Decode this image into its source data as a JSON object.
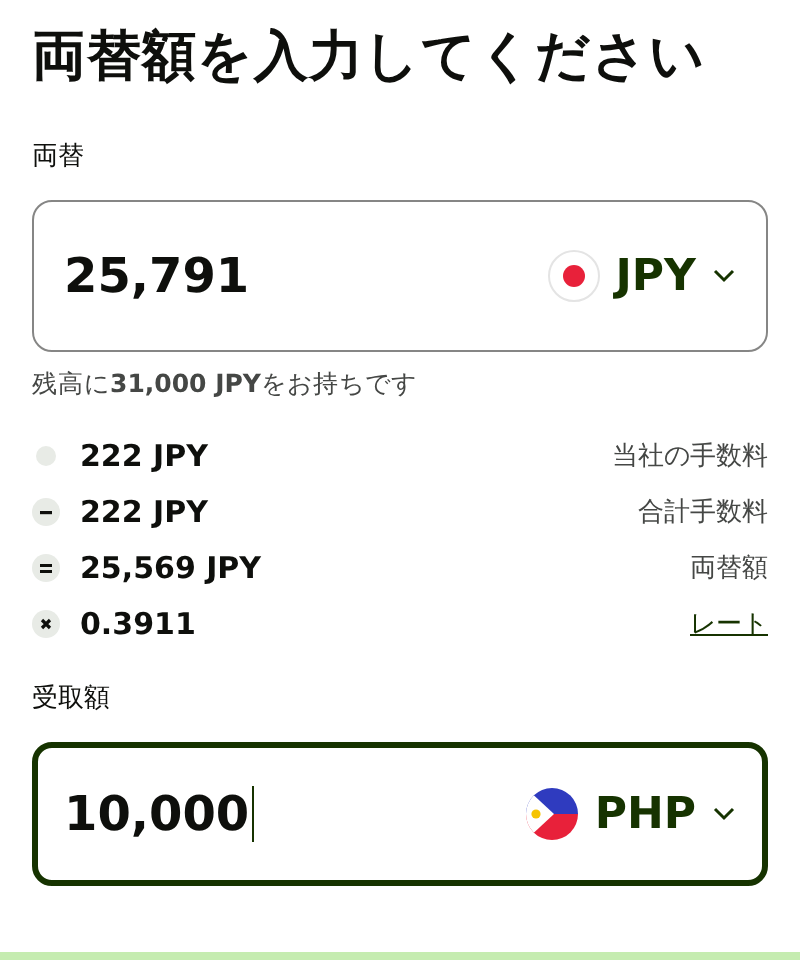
{
  "title": "両替額を入力してください",
  "send": {
    "label": "両替",
    "value": "25,791",
    "focused": false,
    "currency": {
      "code": "JPY",
      "kind": "jp"
    }
  },
  "balance_note": "残高に**31,000 JPY**をお持ちです",
  "breakdown": [
    {
      "kind": "dot",
      "amount": "222 JPY",
      "label": "当社の手数料",
      "link": false
    },
    {
      "kind": "minus",
      "amount": "222 JPY",
      "label": "合計手数料",
      "link": false
    },
    {
      "kind": "equals",
      "amount": "25,569 JPY",
      "label": "両替額",
      "link": false
    },
    {
      "kind": "times",
      "amount": "0.3911",
      "label": "レート",
      "link": true
    }
  ],
  "receive": {
    "label": "受取額",
    "value": "10,000",
    "focused": true,
    "currency": {
      "code": "PHP",
      "kind": "ph"
    }
  }
}
